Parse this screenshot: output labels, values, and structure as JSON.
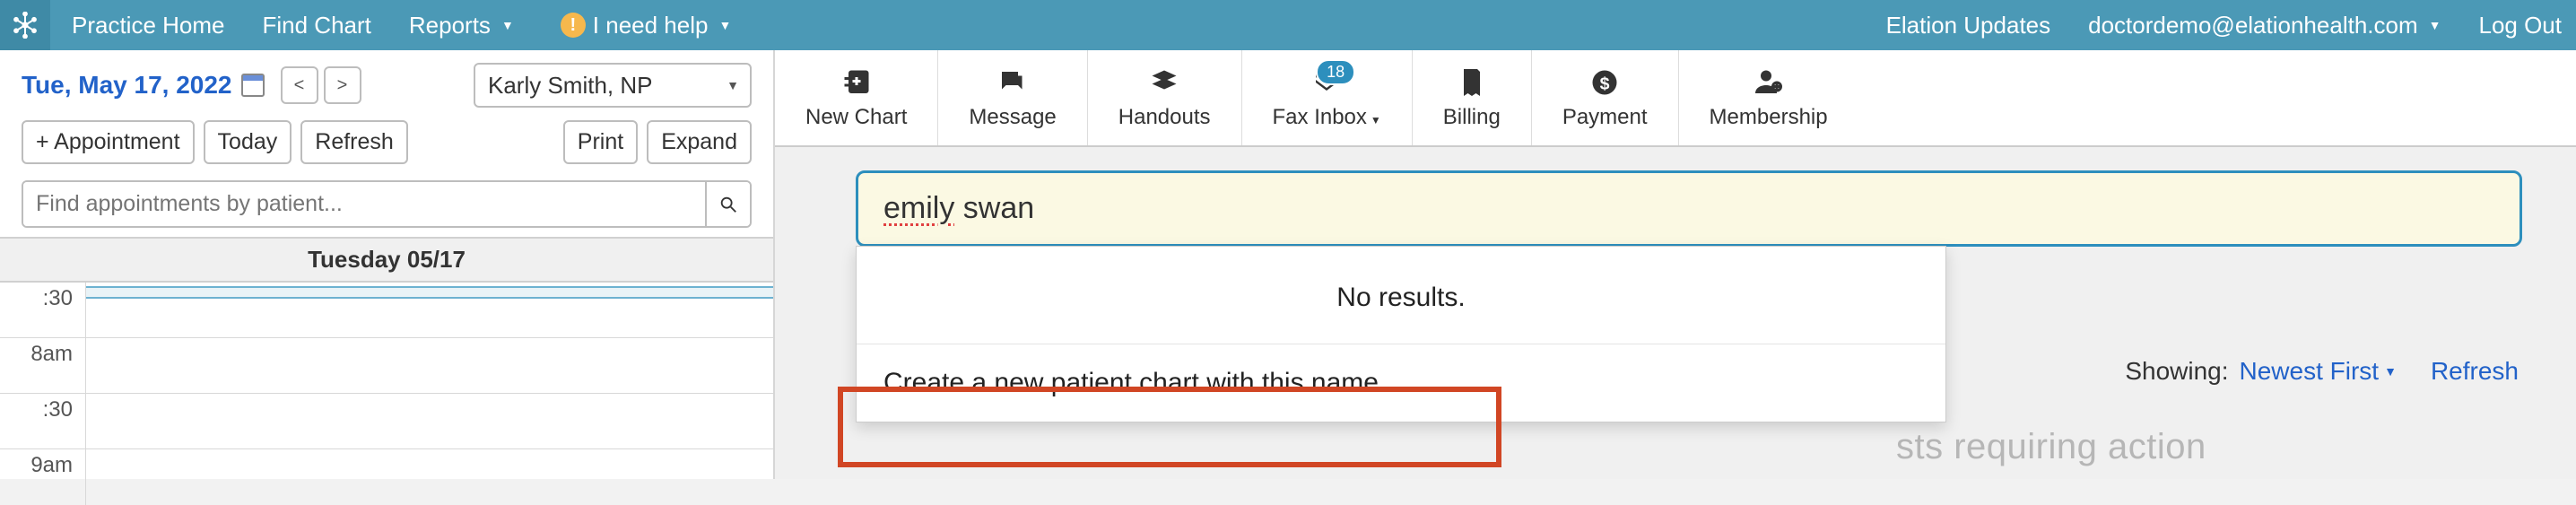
{
  "nav": {
    "left": {
      "practice_home": "Practice Home",
      "find_chart": "Find Chart",
      "reports": "Reports",
      "help": "I need help"
    },
    "right": {
      "updates": "Elation Updates",
      "user_email": "doctordemo@elationhealth.com",
      "logout": "Log Out"
    }
  },
  "sidebar": {
    "date_label": "Tue, May 17, 2022",
    "provider_selected": "Karly Smith, NP",
    "buttons": {
      "add_appointment": "+ Appointment",
      "today": "Today",
      "refresh": "Refresh",
      "print": "Print",
      "expand": "Expand"
    },
    "search_placeholder": "Find appointments by patient...",
    "day_header": "Tuesday 05/17",
    "time_slots": [
      ":30",
      "8am",
      ":30",
      "9am"
    ]
  },
  "toolbar": {
    "new_chart": "New Chart",
    "message": "Message",
    "handouts": "Handouts",
    "fax_inbox": "Fax Inbox",
    "fax_badge": "18",
    "billing": "Billing",
    "payment": "Payment",
    "membership": "Membership"
  },
  "search": {
    "value_misspelled": "emily",
    "value_rest": " swan",
    "no_results": "No results.",
    "create_new": "Create a new patient chart with this name..."
  },
  "ghost": {
    "showing_label": "Showing:",
    "sort": "Newest First",
    "refresh": "Refresh",
    "heading_fragment": "sts requiring action"
  }
}
